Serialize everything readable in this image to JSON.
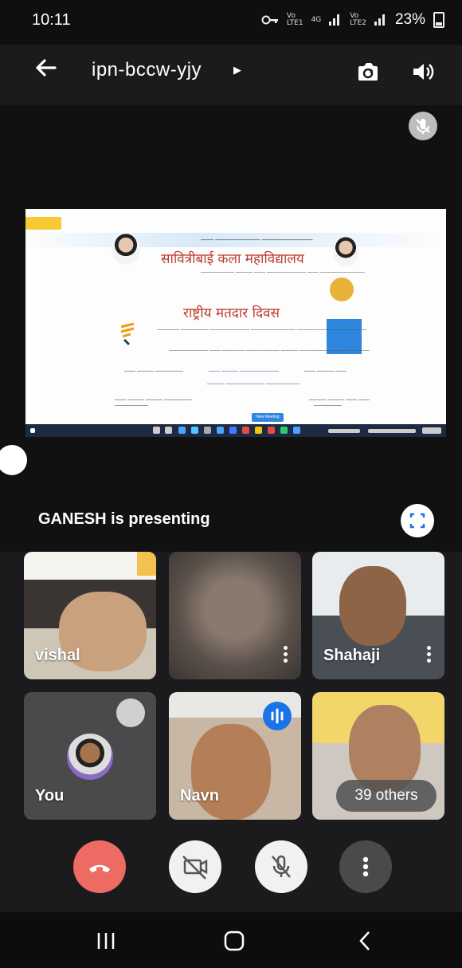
{
  "status_bar": {
    "time": "10:11",
    "sim1_top": "Vo",
    "sim1_bottom": "LTE1",
    "net": "4G",
    "sim2_top": "Vo",
    "sim2_bottom": "LTE2",
    "battery": "23%"
  },
  "top_bar": {
    "meeting_code": "ipn-bccw-yjy"
  },
  "presentation": {
    "label": "GANESH is presenting",
    "slide": {
      "college_name": "सावित्रीबाई कला महाविद्यालय",
      "event_title": "राष्ट्रीय मतदार दिवस",
      "button_text": "New Meeting"
    }
  },
  "participants": [
    {
      "name": "vishal",
      "has_menu": false
    },
    {
      "name": "",
      "has_menu": true
    },
    {
      "name": "Shahaji",
      "has_menu": true
    },
    {
      "name": "You",
      "has_menu": false
    },
    {
      "name": "Navn",
      "has_menu": false
    },
    {
      "name": "39 others",
      "has_menu": false
    }
  ],
  "controls": {
    "end_call_color": "#ee6b64",
    "button_light_color": "#f1f1f1",
    "button_dark_color": "#4a4a4c"
  },
  "icons": {
    "back": "arrow-left-icon",
    "switch_camera": "switch-camera-icon",
    "speaker": "speaker-icon",
    "muted": "mic-off-icon",
    "fullscreen": "fullscreen-icon",
    "end_call": "phone-hangup-icon",
    "camera_off": "camera-off-icon",
    "mic_off": "mic-off-icon",
    "more": "more-vertical-icon",
    "recents": "recents-icon",
    "home": "home-icon",
    "nav_back": "nav-back-icon",
    "speaking": "audio-wave-icon"
  }
}
